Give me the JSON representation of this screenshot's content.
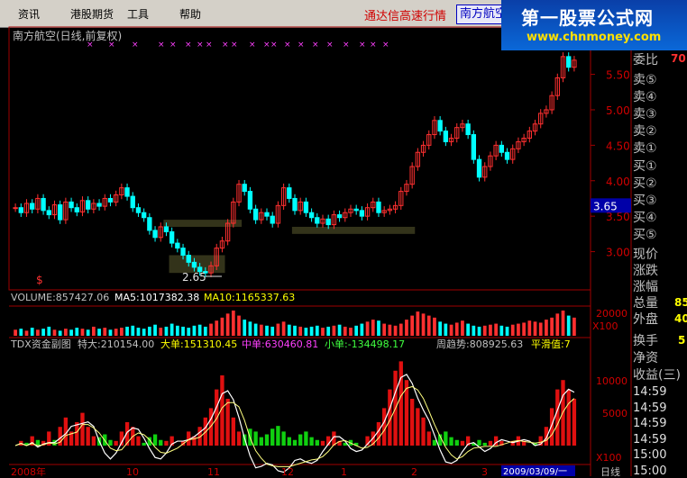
{
  "menu": {
    "items": [
      {
        "label": "资讯",
        "x": 20
      },
      {
        "label": "港股期货",
        "x": 78
      },
      {
        "label": "工具",
        "x": 141
      },
      {
        "label": "帮助",
        "x": 199
      }
    ],
    "broker_title": "通达信高速行情",
    "stock_tab": "南方航空"
  },
  "logo": {
    "title": "第一股票公式网",
    "url": "www.chnmoney.com"
  },
  "main_chart": {
    "title": "南方航空(日线,前复权)",
    "y_ticks": [
      "5.50",
      "5.00",
      "4.50",
      "4.00",
      "3.50",
      "3.00"
    ],
    "last_price": "3.65",
    "low_label": "2.65",
    "signal_marker": "$"
  },
  "volume_panel": {
    "volume_label": "VOLUME:857427.06",
    "ma5_label": "MA5:1017382.38",
    "ma10_label": "MA10:1165337.63",
    "tick": "20000",
    "unit": "X100"
  },
  "indicator_panel": {
    "name_label": "TDX资金副图",
    "super_label": "特大:210154.00",
    "big_label": "大单:151310.45",
    "mid_label": "中单:630460.81",
    "small_label": "小单:-134498.17",
    "trend_label": "周趋势:808925.63",
    "smooth_label": "平滑值:7",
    "ticks": [
      "10000",
      "5000"
    ],
    "unit": "X100"
  },
  "bottom_axis": {
    "labels": [
      "2008年",
      "10",
      "11",
      "12",
      "1",
      "2",
      "3"
    ],
    "date_box": "2009/03/09/一",
    "period": "日线"
  },
  "side_panel": {
    "weibi_label": "委比",
    "weibi_value": "70",
    "sell_levels": [
      "卖⑤",
      "卖④",
      "卖③",
      "卖②",
      "卖①"
    ],
    "buy_levels": [
      "买①",
      "买②",
      "买③",
      "买④",
      "买⑤"
    ],
    "quote_labels": [
      "现价",
      "涨跌",
      "涨幅",
      "总量",
      "外盘"
    ],
    "quote_values": [
      "",
      "",
      "",
      "85",
      "40"
    ],
    "turnover_label": "换手",
    "turnover_value": "5",
    "net_asset_label": "净资",
    "earnings_label": "收益(三)",
    "ticks": [
      "14:59",
      "14:59",
      "14:59",
      "14:59",
      "15:00",
      "15:00"
    ]
  },
  "chart_data": {
    "type": "candlestick",
    "closes": [
      3.62,
      3.55,
      3.68,
      3.6,
      3.75,
      3.58,
      3.52,
      3.66,
      3.45,
      3.7,
      3.62,
      3.56,
      3.72,
      3.6,
      3.68,
      3.64,
      3.75,
      3.7,
      3.8,
      3.9,
      3.78,
      3.62,
      3.55,
      3.48,
      3.3,
      3.2,
      3.35,
      3.28,
      3.12,
      3.05,
      2.95,
      2.85,
      2.78,
      2.72,
      2.7,
      2.8,
      3.05,
      3.15,
      3.4,
      3.7,
      3.95,
      3.85,
      3.6,
      3.45,
      3.55,
      3.5,
      3.4,
      3.65,
      3.9,
      3.75,
      3.58,
      3.7,
      3.55,
      3.48,
      3.4,
      3.46,
      3.38,
      3.52,
      3.48,
      3.55,
      3.6,
      3.58,
      3.5,
      3.62,
      3.7,
      3.55,
      3.58,
      3.6,
      3.65,
      3.85,
      3.95,
      4.2,
      4.4,
      4.5,
      4.65,
      4.85,
      4.7,
      4.55,
      4.6,
      4.75,
      4.8,
      4.65,
      4.3,
      4.05,
      4.2,
      4.35,
      4.5,
      4.4,
      4.3,
      4.45,
      4.55,
      4.6,
      4.7,
      4.8,
      4.95,
      5.0,
      5.2,
      5.45,
      5.75,
      5.6,
      5.7
    ],
    "volume": [
      6,
      7,
      5,
      8,
      6,
      7,
      9,
      6,
      5,
      7,
      6,
      8,
      7,
      6,
      9,
      7,
      8,
      6,
      7,
      8,
      9,
      10,
      8,
      7,
      9,
      11,
      8,
      9,
      12,
      10,
      9,
      8,
      10,
      11,
      9,
      12,
      15,
      18,
      22,
      25,
      20,
      16,
      14,
      12,
      11,
      10,
      9,
      12,
      14,
      11,
      10,
      9,
      8,
      9,
      10,
      8,
      9,
      10,
      11,
      9,
      8,
      10,
      12,
      14,
      16,
      15,
      12,
      11,
      10,
      12,
      16,
      20,
      24,
      22,
      20,
      18,
      14,
      12,
      11,
      13,
      15,
      12,
      10,
      9,
      10,
      11,
      12,
      10,
      9,
      11,
      12,
      13,
      15,
      14,
      13,
      16,
      18,
      22,
      25,
      20,
      18
    ],
    "indicator": [
      0,
      1,
      -1,
      2,
      -2,
      1,
      3,
      -2,
      4,
      6,
      3,
      5,
      7,
      4,
      2,
      -3,
      -4,
      -2,
      1,
      3,
      5,
      4,
      2,
      -1,
      -3,
      -4,
      -2,
      1,
      2,
      0,
      1,
      3,
      2,
      4,
      6,
      8,
      12,
      15,
      10,
      6,
      3,
      -4,
      -6,
      -5,
      -3,
      -4,
      -6,
      -7,
      -5,
      -3,
      -2,
      -4,
      -5,
      -3,
      -2,
      1,
      2,
      3,
      1,
      -1,
      -2,
      -1,
      0,
      2,
      3,
      5,
      8,
      12,
      16,
      18,
      14,
      10,
      8,
      6,
      3,
      -2,
      -4,
      -5,
      -3,
      -2,
      1,
      2,
      -1,
      -2,
      -1,
      1,
      2,
      1,
      0,
      1,
      2,
      1,
      0,
      -1,
      2,
      4,
      8,
      12,
      14,
      12,
      10
    ]
  }
}
